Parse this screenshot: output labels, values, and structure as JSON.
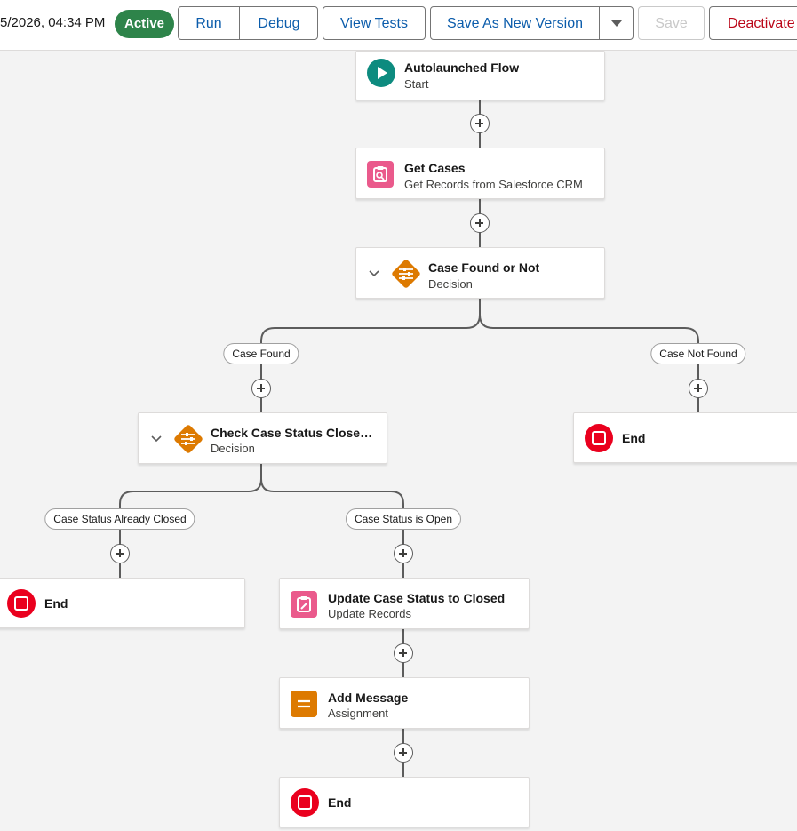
{
  "toolbar": {
    "timestamp": "5/2026, 04:34 PM",
    "status_badge": "Active",
    "run_label": "Run",
    "debug_label": "Debug",
    "view_tests_label": "View Tests",
    "save_as_new_version_label": "Save As New Version",
    "save_label": "Save",
    "deactivate_label": "Deactivate"
  },
  "flow": {
    "start": {
      "title": "Autolaunched Flow",
      "subtitle": "Start"
    },
    "get_cases": {
      "title": "Get Cases",
      "subtitle": "Get Records from Salesforce CRM"
    },
    "decision1": {
      "title": "Case Found or Not",
      "subtitle": "Decision",
      "outcomes": [
        "Case Found",
        "Case Not Found"
      ]
    },
    "decision2": {
      "title": "Check Case Status Closed or ...",
      "subtitle": "Decision",
      "outcomes": [
        "Case Status Already Closed",
        "Case Status is Open"
      ]
    },
    "end_not_found": {
      "title": "End"
    },
    "end_closed": {
      "title": "End"
    },
    "update_case": {
      "title": "Update Case Status to Closed",
      "subtitle": "Update Records"
    },
    "add_message": {
      "title": "Add Message",
      "subtitle": "Assignment"
    },
    "end_final": {
      "title": "End"
    }
  },
  "colors": {
    "active_badge": "#2e844a",
    "start_icon": "#0d8b7f",
    "record_icon": "#ea5a8c",
    "decision_icon": "#dd7a01",
    "end_icon": "#ea001e",
    "brand_text": "#0b5cab",
    "destructive_text": "#ba0517"
  },
  "icons": {
    "start": "play-icon",
    "get_records": "clipboard-search-icon",
    "decision": "decision-diamond-icon",
    "update_records": "clipboard-edit-icon",
    "assignment": "equals-icon",
    "end": "stop-icon",
    "dropdown": "caret-down-icon",
    "collapse": "chevron-down-icon",
    "add_element": "plus-icon"
  }
}
